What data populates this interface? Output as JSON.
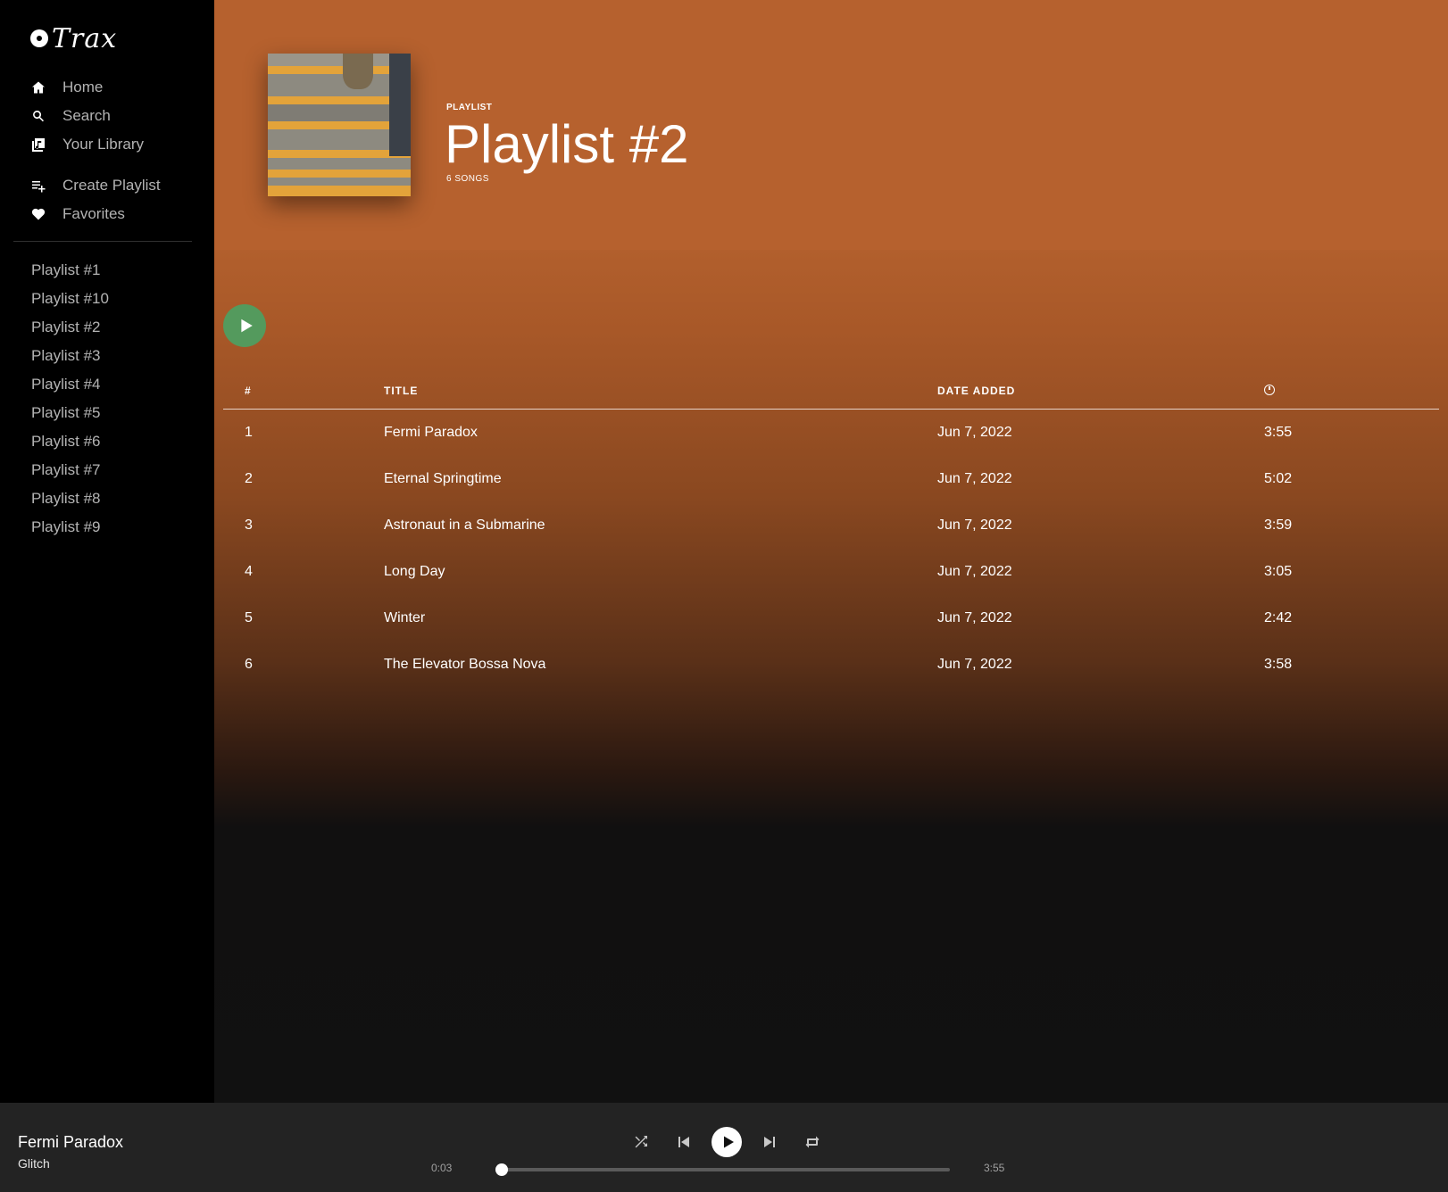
{
  "app": {
    "logo_text": "Trax"
  },
  "sidebar": {
    "main_nav": [
      {
        "label": "Home",
        "icon": "home-icon"
      },
      {
        "label": "Search",
        "icon": "search-icon"
      },
      {
        "label": "Your Library",
        "icon": "library-icon"
      }
    ],
    "action_nav": [
      {
        "label": "Create Playlist",
        "icon": "playlist-add-icon"
      },
      {
        "label": "Favorites",
        "icon": "heart-icon"
      }
    ],
    "playlists": [
      "Playlist #1",
      "Playlist #10",
      "Playlist #2",
      "Playlist #3",
      "Playlist #4",
      "Playlist #5",
      "Playlist #6",
      "Playlist #7",
      "Playlist #8",
      "Playlist #9"
    ]
  },
  "hero": {
    "type_label": "PLAYLIST",
    "title": "Playlist #2",
    "count_label": "6 SONGS",
    "background_color": "#b6612e"
  },
  "table": {
    "headers": {
      "num": "#",
      "title": "TITLE",
      "date": "DATE ADDED",
      "duration_icon": "clock-icon"
    },
    "rows": [
      {
        "num": "1",
        "title": "Fermi Paradox",
        "date": "Jun 7, 2022",
        "duration": "3:55"
      },
      {
        "num": "2",
        "title": "Eternal Springtime",
        "date": "Jun 7, 2022",
        "duration": "5:02"
      },
      {
        "num": "3",
        "title": "Astronaut in a Submarine",
        "date": "Jun 7, 2022",
        "duration": "3:59"
      },
      {
        "num": "4",
        "title": "Long Day",
        "date": "Jun 7, 2022",
        "duration": "3:05"
      },
      {
        "num": "5",
        "title": "Winter",
        "date": "Jun 7, 2022",
        "duration": "2:42"
      },
      {
        "num": "6",
        "title": "The Elevator Bossa Nova",
        "date": "Jun 7, 2022",
        "duration": "3:58"
      }
    ]
  },
  "player": {
    "now_playing_title": "Fermi Paradox",
    "now_playing_artist": "Glitch",
    "elapsed": "0:03",
    "total": "3:55",
    "progress_fraction": 0.0128,
    "accent_color": "#549a5d"
  }
}
